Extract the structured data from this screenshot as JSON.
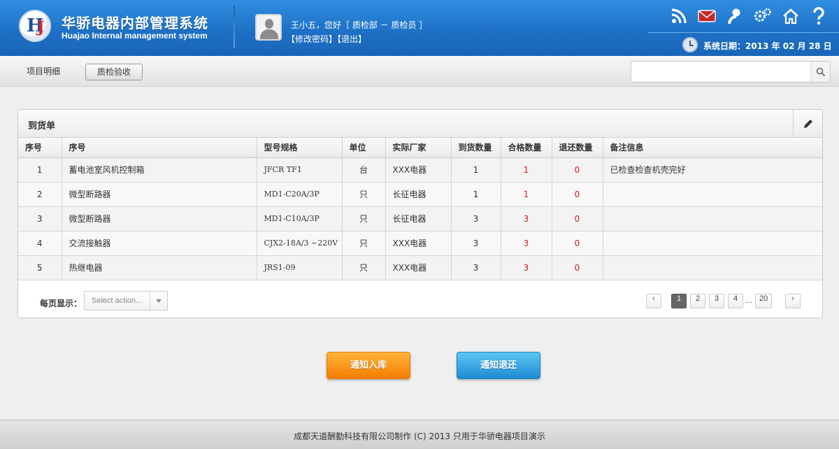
{
  "header": {
    "logo_title": "华骄电器内部管理系统",
    "logo_subtitle": "Huajao Internal management system",
    "user_greeting": "王小五，您好［ 质检部 － 质检员 ］",
    "change_password": "【修改密码】",
    "logout": "【退出】",
    "icons": [
      "rss-icon",
      "mail-icon",
      "user-icon",
      "settings-icon",
      "home-icon",
      "help-icon"
    ],
    "system_date": "系统日期：2013 年 02 月 28 日"
  },
  "tabs": {
    "items": [
      {
        "label": "项目明细"
      },
      {
        "label": "质检验收"
      }
    ],
    "active": "质检验收"
  },
  "search": {
    "placeholder": "",
    "value": ""
  },
  "panel": {
    "title": "到货单",
    "columns": [
      "序号",
      "序号",
      "型号规格",
      "单位",
      "实际厂家",
      "到货数量",
      "合格数量",
      "退还数量",
      "备注信息"
    ],
    "rows": [
      {
        "no": "1",
        "name": "蓄电池室风机控制箱",
        "model": "JFCR TF1",
        "unit": "台",
        "maker": "XXX电器",
        "arrived": "1",
        "qualified": "1",
        "returned": "0",
        "remark": "已检查检查机壳完好"
      },
      {
        "no": "2",
        "name": "微型断路器",
        "model": "MD1-C20A/3P",
        "unit": "只",
        "maker": "长征电器",
        "arrived": "1",
        "qualified": "1",
        "returned": "0",
        "remark": ""
      },
      {
        "no": "3",
        "name": "微型断路器",
        "model": "MD1-C10A/3P",
        "unit": "只",
        "maker": "长征电器",
        "arrived": "3",
        "qualified": "3",
        "returned": "0",
        "remark": ""
      },
      {
        "no": "4",
        "name": "交流接触器",
        "model": "CJX2-18A/3 ~220V",
        "unit": "只",
        "maker": "XXX电器",
        "arrived": "3",
        "qualified": "3",
        "returned": "0",
        "remark": ""
      },
      {
        "no": "5",
        "name": "热继电器",
        "model": "JRS1-09",
        "unit": "只",
        "maker": "XXX电器",
        "arrived": "3",
        "qualified": "3",
        "returned": "0",
        "remark": ""
      }
    ],
    "per_page_label": "每页显示：",
    "per_page_placeholder": "Select action...",
    "pagination": {
      "prev": "‹",
      "pages": [
        "1",
        "2",
        "3",
        "4"
      ],
      "ellipsis": "...",
      "last": "20",
      "next": "›",
      "current": "1"
    }
  },
  "actions": {
    "notify_instock": "通知入库",
    "notify_return": "通知退还"
  },
  "footer": {
    "text": "成都天道酬勤科技有限公司制作 (C) 2013 只用于华骄电器项目演示"
  },
  "colors": {
    "header_blue": "#1d6fc4",
    "orange": "#f57c00",
    "blue": "#1e8bd3",
    "red": "#d01d1d"
  }
}
